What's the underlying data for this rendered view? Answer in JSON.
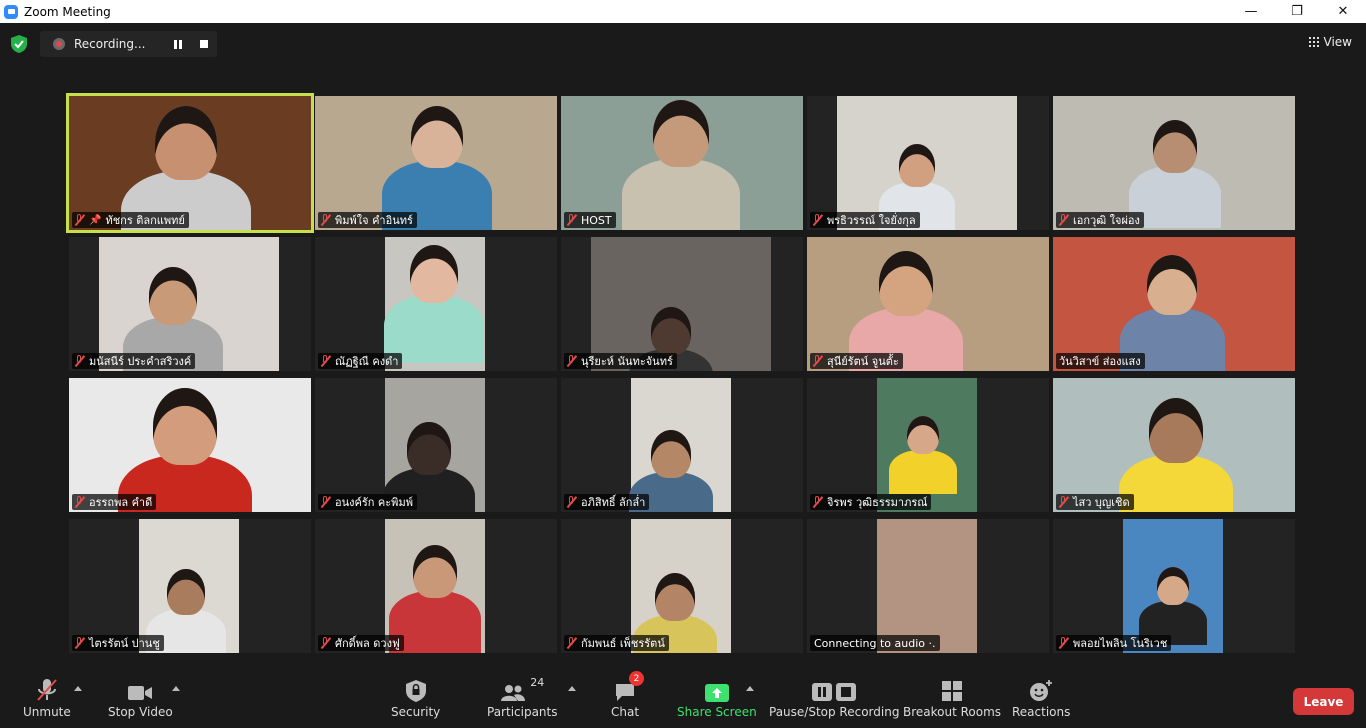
{
  "window": {
    "title": "Zoom Meeting",
    "minimize": "—",
    "maximize": "❐",
    "close": "✕"
  },
  "topbar": {
    "recording_label": "Recording...",
    "view_label": "View"
  },
  "participants": [
    {
      "name": "ทัชกร ติลกแพทย์",
      "muted": true,
      "pinned": true,
      "active": true
    },
    {
      "name": "พิมพ์ใจ คำอินทร์",
      "muted": true
    },
    {
      "name": "HOST",
      "muted": true
    },
    {
      "name": "พรธิวรรณ์ ใจยั่งกุล",
      "muted": true
    },
    {
      "name": "เอกวุฒิ ใจผ่อง",
      "muted": true
    },
    {
      "name": "มนัสนีร์ ประคำสริวงค์",
      "muted": true
    },
    {
      "name": "ณัฏฐิณี คงดำ",
      "muted": true
    },
    {
      "name": "นุรียะห์ นันทะจันทร์",
      "muted": true
    },
    {
      "name": "สุนีย์รัตน์ จูนตั้ะ",
      "muted": true
    },
    {
      "name": "วันวิสาข์ ส่องแสง",
      "muted": false
    },
    {
      "name": "อรรถพล คำดี",
      "muted": true
    },
    {
      "name": "อนงค์รัก คะพิมพ์",
      "muted": true
    },
    {
      "name": "อภิสิทธิ์ ลักล่ำ",
      "muted": true
    },
    {
      "name": "จิรพร วุฒิธรรมาภรณ์",
      "muted": true
    },
    {
      "name": "ไสว บุญเชิด",
      "muted": true
    },
    {
      "name": "ไตรรัตน์ ปานชู",
      "muted": true
    },
    {
      "name": "ศักดิ์พล ดวงฟู",
      "muted": true
    },
    {
      "name": "กัมพนธ์ เพ็ชรรัตน์",
      "muted": true
    },
    {
      "name": "Connecting to audio ·.",
      "muted": false,
      "connecting": true
    },
    {
      "name": "พลอยไพลิน โนริเวช",
      "muted": true
    }
  ],
  "toolbar": {
    "unmute": "Unmute",
    "stop_video": "Stop Video",
    "security": "Security",
    "participants": "Participants",
    "participant_count": "24",
    "chat": "Chat",
    "chat_badge": "2",
    "share_screen": "Share Screen",
    "pause_stop_recording": "Pause/Stop Recording",
    "breakout_rooms": "Breakout Rooms",
    "reactions": "Reactions",
    "leave": "Leave"
  },
  "colors": {
    "accent_active": "#c5e04a",
    "leave": "#d43838",
    "share": "#3ee06f",
    "muted_icon": "#e34b4b"
  }
}
